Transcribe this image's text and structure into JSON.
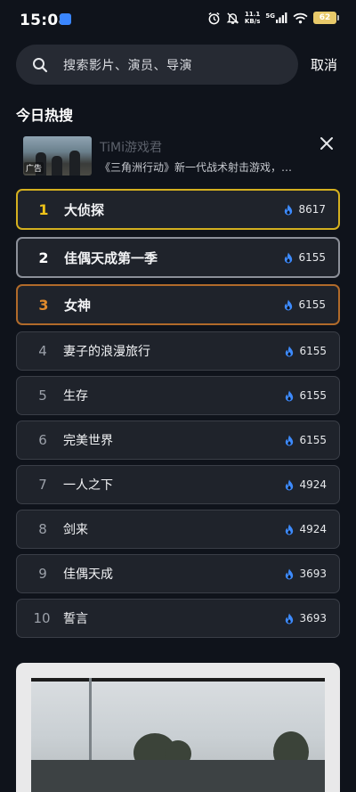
{
  "status": {
    "time": "15:08",
    "net_speed_value": "11.1",
    "net_speed_unit": "KB/s",
    "signal_label": "5G",
    "battery": "62"
  },
  "search": {
    "placeholder": "搜索影片、演员、导演",
    "cancel_label": "取消"
  },
  "section_title": "今日热搜",
  "ad": {
    "name": "TiMi游戏君",
    "tag": "广告",
    "description": "《三角洲行动》新一代战术射击游戏，…"
  },
  "hot_list": [
    {
      "rank": "1",
      "title": "大侦探",
      "count": "8617"
    },
    {
      "rank": "2",
      "title": "佳偶天成第一季",
      "count": "6155"
    },
    {
      "rank": "3",
      "title": "女神",
      "count": "6155"
    },
    {
      "rank": "4",
      "title": "妻子的浪漫旅行",
      "count": "6155"
    },
    {
      "rank": "5",
      "title": "生存",
      "count": "6155"
    },
    {
      "rank": "6",
      "title": "完美世界",
      "count": "6155"
    },
    {
      "rank": "7",
      "title": "一人之下",
      "count": "4924"
    },
    {
      "rank": "8",
      "title": "剑来",
      "count": "4924"
    },
    {
      "rank": "9",
      "title": "佳偶天成",
      "count": "3693"
    },
    {
      "rank": "10",
      "title": "誓言",
      "count": "3693"
    }
  ],
  "colors": {
    "background": "#0f131b",
    "rank1_border": "#d4b01f",
    "rank1_number": "#f0c419",
    "rank2_border": "#8c9099",
    "rank2_number": "#ffffff",
    "rank3_border": "#b06a2a",
    "rank3_number": "#e08a2c",
    "flame": "#3d8bff"
  },
  "icons": {
    "search": "search-icon",
    "close": "close-icon",
    "hot": "flame-icon",
    "alarm": "alarm-icon",
    "mute": "bell-off-icon",
    "wifi": "wifi-icon"
  }
}
